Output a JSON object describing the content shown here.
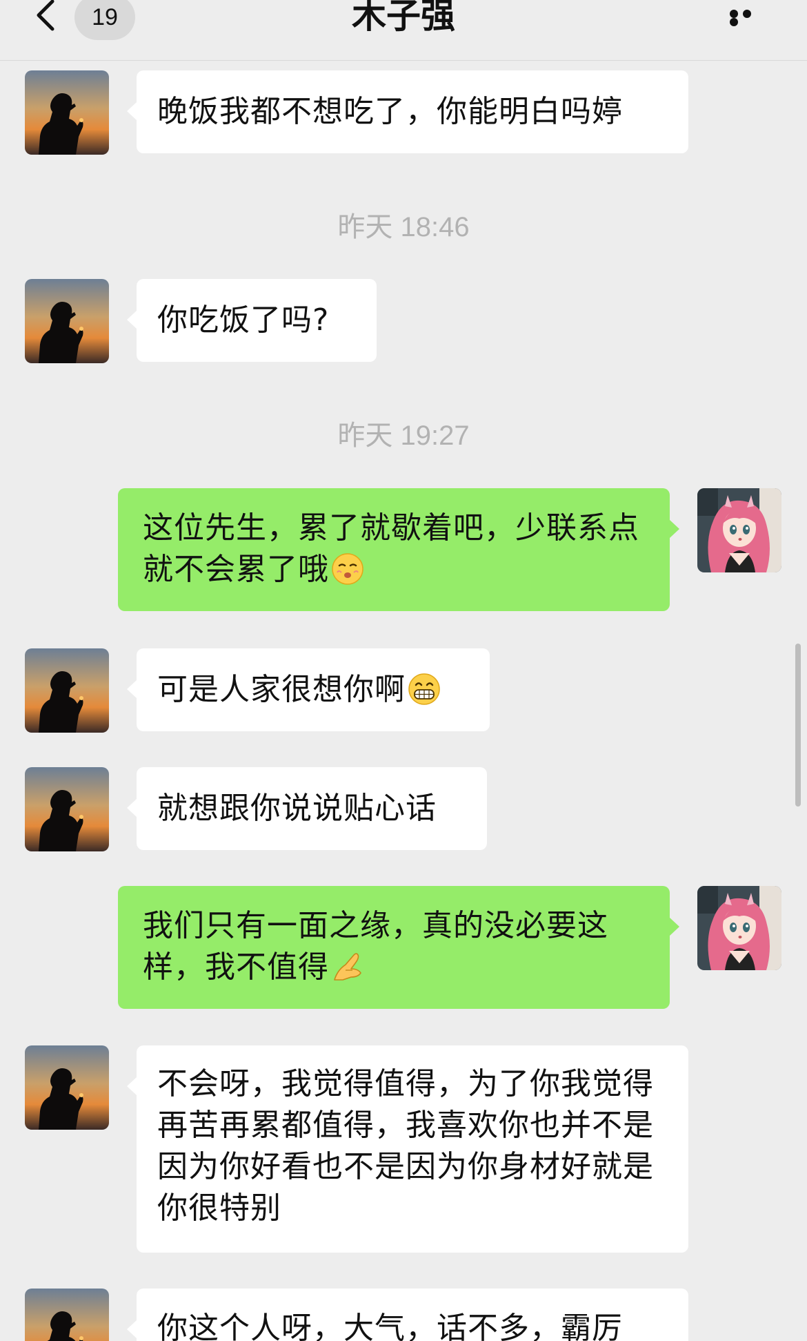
{
  "header": {
    "unread_count": "19",
    "title": "木子强"
  },
  "messages": [
    {
      "type": "text",
      "sender": "contact",
      "text": "晚饭我都不想吃了，你能明白吗婷"
    },
    {
      "type": "time",
      "text": "昨天 18:46"
    },
    {
      "type": "text",
      "sender": "contact",
      "text": "你吃饭了吗?"
    },
    {
      "type": "time",
      "text": "昨天 19:27"
    },
    {
      "type": "text",
      "sender": "me",
      "text": "这位先生，累了就歇着吧，少联系点就不会累了哦",
      "emoji": "shushing-face"
    },
    {
      "type": "text",
      "sender": "contact",
      "text": "可是人家很想你啊",
      "emoji": "grinning-face"
    },
    {
      "type": "text",
      "sender": "contact",
      "text": "就想跟你说说贴心话"
    },
    {
      "type": "text",
      "sender": "me",
      "text": "我们只有一面之缘，真的没必要这样，我不值得",
      "emoji": "pinched-fingers"
    },
    {
      "type": "text",
      "sender": "contact",
      "text": "不会呀，我觉得值得，为了你我觉得再苦再累都值得，我喜欢你也并不是因为你好看也不是因为你身材好就是你很特别"
    },
    {
      "type": "text",
      "sender": "contact",
      "text": "你这个人呀，大气，话不多，霸厉"
    }
  ],
  "colors": {
    "background": "#ededed",
    "incoming_bubble": "#ffffff",
    "outgoing_bubble": "#95ec69",
    "timestamp_text": "#b2b2b2"
  }
}
